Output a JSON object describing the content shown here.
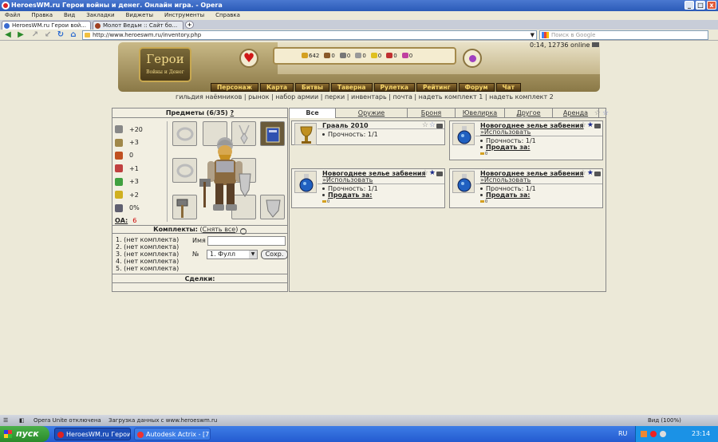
{
  "browser": {
    "title": "HeroesWM.ru Герои войны и денег. Онлайн игра. - Opera",
    "menu": [
      "Файл",
      "Правка",
      "Вид",
      "Закладки",
      "Виджеты",
      "Инструменты",
      "Справка"
    ],
    "tabs": [
      "HeroesWM.ru Герои вой...",
      "Молот Ведьм :: Сайт бо..."
    ],
    "new_tab": "+",
    "url": "http://www.heroeswm.ru/inventory.php",
    "search_placeholder": "Поиск в Google",
    "window_buttons": [
      "_",
      "□",
      "x"
    ]
  },
  "header": {
    "logo_title": "Герои",
    "logo_sub": "Войны и Денег",
    "clock": "0:14, 12736 online",
    "resources": [
      {
        "icon": "gold-icon",
        "value": "642",
        "color": "#d4a020"
      },
      {
        "icon": "wood-icon",
        "value": "0",
        "color": "#8a5a2a"
      },
      {
        "icon": "ore-icon",
        "value": "0",
        "color": "#777777"
      },
      {
        "icon": "mercury-icon",
        "value": "0",
        "color": "#999999"
      },
      {
        "icon": "sulfur-icon",
        "value": "0",
        "color": "#e0c020"
      },
      {
        "icon": "crystal-icon",
        "value": "0",
        "color": "#c03030"
      },
      {
        "icon": "gems-icon",
        "value": "0",
        "color": "#c040a0"
      }
    ],
    "nav": [
      "Персонаж",
      "Карта",
      "Битвы",
      "Таверна",
      "Рулетка",
      "Рейтинг",
      "Форум",
      "Чат"
    ],
    "sublinks": [
      "гильдия наёмников",
      "рынок",
      "набор армии",
      "перки",
      "инвентарь",
      "почта",
      "надеть комплект 1",
      "надеть комплект 2"
    ]
  },
  "inventory": {
    "title": "Предметы (6/35)",
    "help": "?",
    "stats": [
      {
        "icon": "attack-icon",
        "value": "+20",
        "color": "#888888"
      },
      {
        "icon": "defense-icon",
        "value": "+3",
        "color": "#a0884a"
      },
      {
        "icon": "spellpower-icon",
        "value": "0",
        "color": "#c05020"
      },
      {
        "icon": "knowledge-icon",
        "value": "+1",
        "color": "#c04040"
      },
      {
        "icon": "luck-icon",
        "value": "+3",
        "color": "#40a040"
      },
      {
        "icon": "morale-icon",
        "value": "+2",
        "color": "#d0b020"
      },
      {
        "icon": "initiative-icon",
        "value": "0%",
        "color": "#606070"
      }
    ],
    "oa_label": "ОА:",
    "oa_value": "6",
    "kits_label": "Комплекты:",
    "kits_remove": "Снять все",
    "kits_toggle": "^",
    "kits": [
      "1. (нет комплекта)",
      "2. (нет комплекта)",
      "3. (нет комплекта)",
      "4. (нет комплекта)",
      "5. (нет комплекта)"
    ],
    "name_label": "Имя",
    "num_label": "№",
    "num_value": "1. Фулл",
    "save_label": "Сохр.",
    "deals_label": "Сделки:"
  },
  "item_tabs": [
    "Все",
    "Оружие",
    "Броня",
    "Ювелирка",
    "Другое",
    "Аренда"
  ],
  "items": [
    {
      "name": "Грааль 2010",
      "use": "",
      "durability": "Прочность: 1/1",
      "sell": "Продать за:",
      "gold": "",
      "starred": false
    },
    {
      "name": "Новогоднее зелье забвения",
      "use": "»Использовать",
      "durability": "Прочность: 1/1",
      "sell": "Продать за:",
      "gold": "0",
      "starred": true
    },
    {
      "name": "Новогоднее зелье забвения",
      "use": "»Использовать",
      "durability": "Прочность: 1/1",
      "sell": "Продать за:",
      "gold": "0",
      "starred": true
    },
    {
      "name": "Новогоднее зелье забвения",
      "use": "»Использовать",
      "durability": "Прочность: 1/1",
      "sell": "Продать за:",
      "gold": "0",
      "starred": true
    }
  ],
  "status": {
    "unite": "Opera Unite отключена",
    "loading": "Загрузка данных с www.heroeswm.ru",
    "zoom": "Вид (100%)"
  },
  "taskbar": {
    "start": "пуск",
    "tasks": [
      "HeroesWM.ru Герои ...",
      "Autodesk Actrix - [7...."
    ],
    "lang": "RU",
    "time": "23:14"
  }
}
